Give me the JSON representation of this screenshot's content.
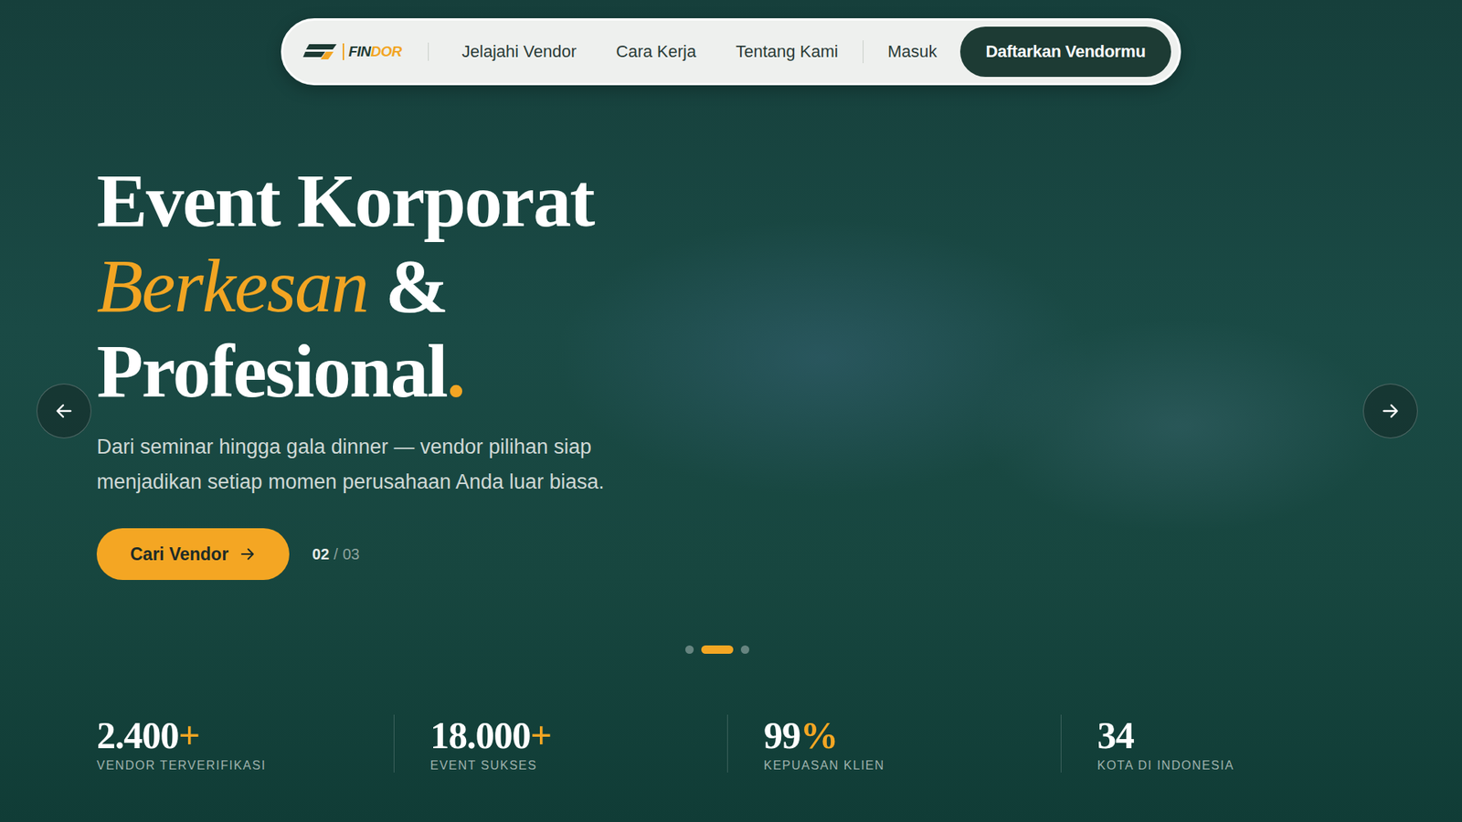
{
  "nav": {
    "logo": {
      "main": "FIN",
      "accent": "DOR"
    },
    "links": [
      "Jelajahi Vendor",
      "Cara Kerja",
      "Tentang Kami"
    ],
    "login": "Masuk",
    "cta": "Daftarkan Vendormu"
  },
  "hero": {
    "title": {
      "line1": "Event Korporat",
      "line2_accent": "Berkesan",
      "line2_rest": "&",
      "line3": "Profesional",
      "line3_dot": "."
    },
    "subtitle": "Dari seminar hingga gala dinner — vendor pilihan siap menjadikan setiap momen perusahaan Anda luar biasa.",
    "button": "Cari Vendor",
    "counter": {
      "current": "02",
      "separator": "/",
      "total": "03"
    }
  },
  "carousel": {
    "dots": [
      {
        "selected": false
      },
      {
        "selected": true
      },
      {
        "selected": false
      }
    ]
  },
  "stats": [
    {
      "value": "2.400",
      "suffix": "+",
      "label": "VENDOR TERVERIFIKASI"
    },
    {
      "value": "18.000",
      "suffix": "+",
      "label": "EVENT SUKSES"
    },
    {
      "value": "99",
      "suffix": "%",
      "label": "KEPUASAN KLIEN"
    },
    {
      "value": "34",
      "suffix": "",
      "label": "KOTA DI INDONESIA"
    }
  ]
}
